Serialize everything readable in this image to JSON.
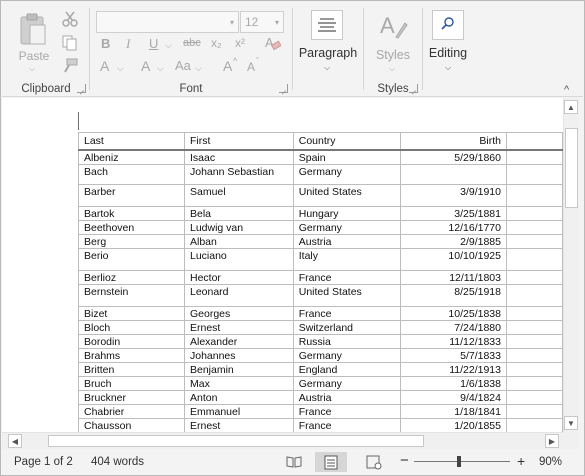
{
  "ribbon": {
    "clipboard": {
      "label": "Clipboard",
      "paste_label": "Paste"
    },
    "font": {
      "label": "Font",
      "font_name": "",
      "font_size": "12",
      "bold": "B",
      "italic": "I",
      "underline": "U",
      "strike": "abc",
      "subscript": "x₂",
      "superscript": "x²",
      "text_effects": "A",
      "font_color": "A",
      "change_case": "Aa",
      "grow": "A",
      "shrink": "A"
    },
    "paragraph": {
      "label": "Paragraph"
    },
    "styles": {
      "label": "Styles",
      "button_label": "Styles"
    },
    "editing": {
      "label": "Editing"
    }
  },
  "table": {
    "columns": [
      "Last",
      "First",
      "Country",
      "Birth"
    ],
    "rows": [
      [
        "Albeniz",
        "Isaac",
        "Spain",
        "5/29/1860"
      ],
      [
        "Bach",
        "Johann Sebastian",
        "Germany",
        ""
      ],
      [
        "Barber",
        "Samuel",
        "United States",
        "3/9/1910"
      ],
      [
        "Bartok",
        "Bela",
        "Hungary",
        "3/25/1881"
      ],
      [
        "Beethoven",
        "Ludwig van",
        "Germany",
        "12/16/1770"
      ],
      [
        "Berg",
        "Alban",
        "Austria",
        "2/9/1885"
      ],
      [
        "Berio",
        "Luciano",
        "Italy",
        "10/10/1925"
      ],
      [
        "Berlioz",
        "Hector",
        "France",
        "12/11/1803"
      ],
      [
        "Bernstein",
        "Leonard",
        "United States",
        "8/25/1918"
      ],
      [
        "Bizet",
        "Georges",
        "France",
        "10/25/1838"
      ],
      [
        "Bloch",
        "Ernest",
        "Switzerland",
        "7/24/1880"
      ],
      [
        "Borodin",
        "Alexander",
        "Russia",
        "11/12/1833"
      ],
      [
        "Brahms",
        "Johannes",
        "Germany",
        "5/7/1833"
      ],
      [
        "Britten",
        "Benjamin",
        "England",
        "11/22/1913"
      ],
      [
        "Bruch",
        "Max",
        "Germany",
        "1/6/1838"
      ],
      [
        "Bruckner",
        "Anton",
        "Austria",
        "9/4/1824"
      ],
      [
        "Chabrier",
        "Emmanuel",
        "France",
        "1/18/1841"
      ],
      [
        "Chausson",
        "Ernest",
        "France",
        "1/20/1855"
      ]
    ]
  },
  "status": {
    "page": "Page 1 of 2",
    "words": "404 words",
    "zoom": "90%",
    "zoom_minus": "−",
    "zoom_plus": "+"
  }
}
